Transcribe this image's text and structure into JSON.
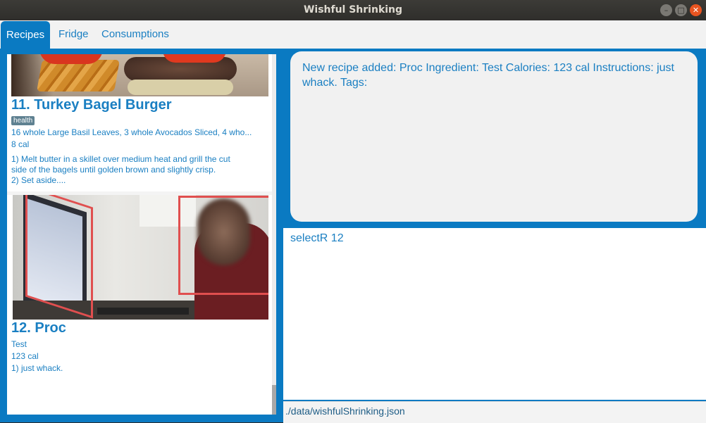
{
  "window": {
    "title": "Wishful Shrinking"
  },
  "tabs": [
    {
      "label": "Recipes",
      "active": true
    },
    {
      "label": "Fridge",
      "active": false
    },
    {
      "label": "Consumptions",
      "active": false
    }
  ],
  "recipes": [
    {
      "title": "11.  Turkey Bagel Burger",
      "tag": "health",
      "ingredients": "16 whole Large Basil Leaves, 3 whole Avocados Sliced, 4 who...",
      "calories": "8 cal",
      "instructions": [
        "1) Melt butter in a skillet over medium heat and grill the cut",
        "side of the bagels until golden brown and slightly crisp.",
        "2) Set aside...."
      ]
    },
    {
      "title": "12.  Proc",
      "ingredients": " Test",
      "calories": "123 cal",
      "instructions": [
        "1) just whack."
      ]
    }
  ],
  "result_box": {
    "text": "New recipe added: Proc Ingredient:  Test Calories: 123 cal Instructions: just whack. Tags:"
  },
  "command_box": {
    "text": "selectR 12"
  },
  "status_bar": {
    "path": "./data/wishfulShrinking.json"
  },
  "colors": {
    "accent": "#0a7ac2",
    "text": "#1a7fc2",
    "tag_bg": "#5f8191"
  }
}
